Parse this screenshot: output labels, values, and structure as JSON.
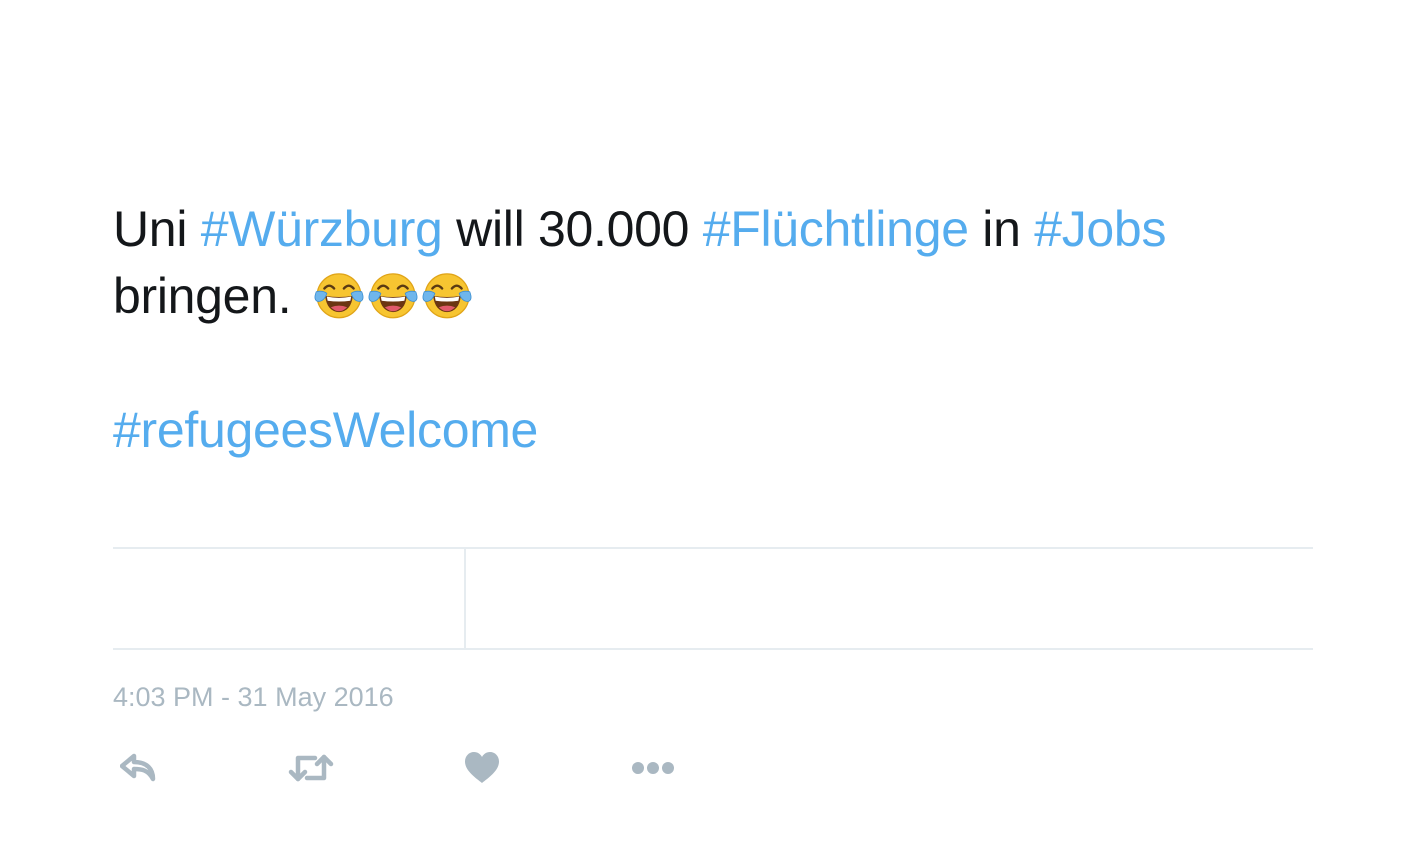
{
  "tweet": {
    "text": {
      "line1": [
        {
          "type": "text",
          "value": "Uni "
        },
        {
          "type": "hashtag",
          "value": "#Würzburg"
        },
        {
          "type": "text",
          "value": " will 30.000 "
        },
        {
          "type": "hashtag",
          "value": "#Flüchtlinge"
        },
        {
          "type": "text",
          "value": " in "
        },
        {
          "type": "hashtag",
          "value": "#Jobs"
        }
      ],
      "line2": "bringen.",
      "emoji_name": "face-with-tears-of-joy-emoji",
      "emoji_count": 3,
      "hashtag_line": "#refugeesWelcome"
    },
    "timestamp": "4:03 PM - 31 May 2016",
    "actions": [
      "reply-icon",
      "retweet-icon",
      "like-heart-icon",
      "more-dots-icon"
    ],
    "colors": {
      "text": "#14171a",
      "hashtag": "#55acee",
      "muted": "#aab8c2",
      "divider": "#e6ecf0"
    }
  }
}
